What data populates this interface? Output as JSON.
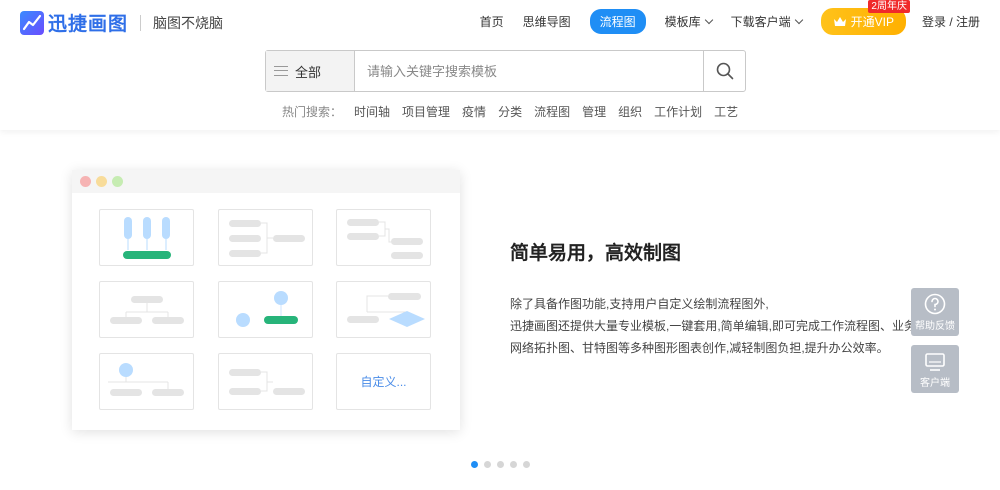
{
  "brand": {
    "name": "迅捷画图",
    "slogan": "脑图不烧脑"
  },
  "nav": {
    "items": [
      {
        "label": "首页"
      },
      {
        "label": "思维导图"
      },
      {
        "label": "流程图",
        "active": true
      },
      {
        "label": "模板库",
        "dropdown": true
      },
      {
        "label": "下载客户端",
        "dropdown": true
      }
    ],
    "vip_label": "开通VIP",
    "vip_badge": "2周年庆",
    "login_label": "登录 / 注册"
  },
  "search": {
    "category": "全部",
    "placeholder": "请输入关键字搜索模板",
    "hot_label": "热门搜索：",
    "hot_items": [
      "时间轴",
      "项目管理",
      "疫情",
      "分类",
      "流程图",
      "管理",
      "组织",
      "工作计划",
      "工艺"
    ]
  },
  "preview": {
    "custom_label": "自定义..."
  },
  "feature": {
    "title": "简单易用，高效制图",
    "lines": [
      "除了具备作图功能,支持用户自定义绘制流程图外,",
      "迅捷画图还提供大量专业模板,一键套用,简单编辑,即可完成工作流程图、业务流程图、",
      "网络拓扑图、甘特图等多种图形图表创作,减轻制图负担,提升办公效率。"
    ]
  },
  "float": {
    "help_label": "帮助反馈",
    "client_label": "客户端"
  },
  "carousel": {
    "total": 5,
    "current": 1
  },
  "colors": {
    "primary": "#1f8ef5",
    "vip": "#ffb000",
    "accent_green": "#27b47a",
    "tile_blue": "#b9dcff"
  }
}
